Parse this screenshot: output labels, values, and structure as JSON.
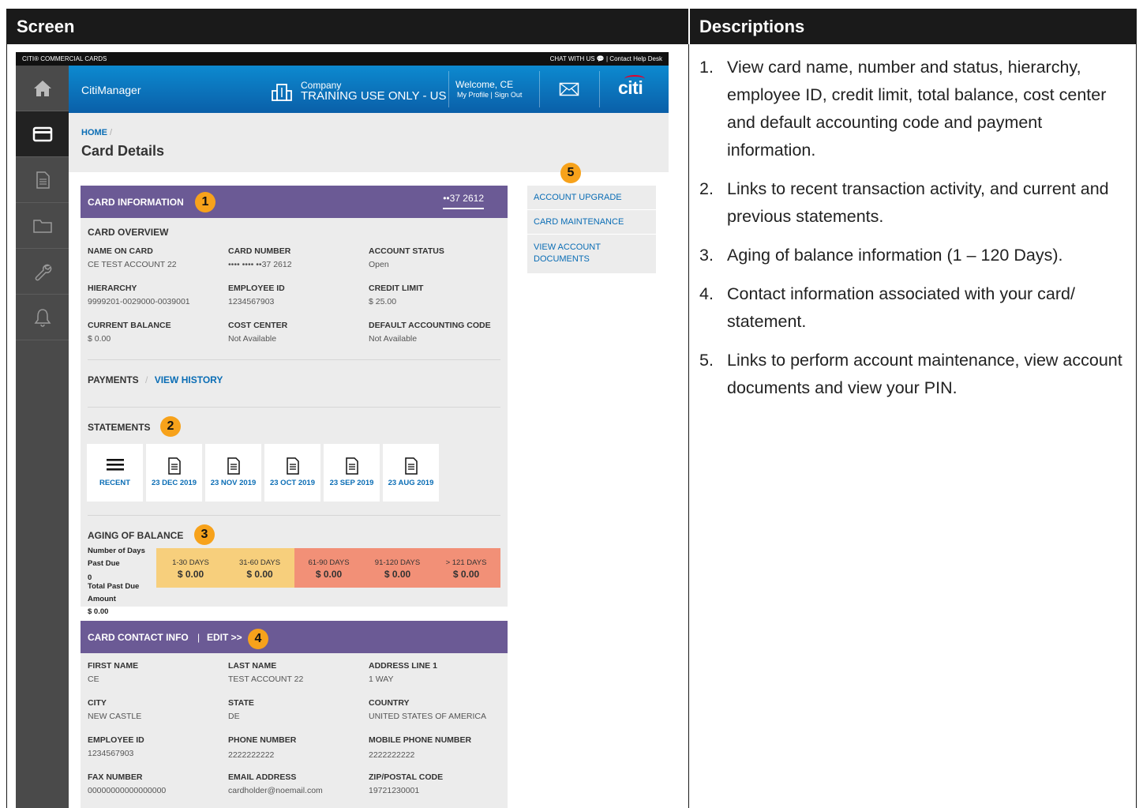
{
  "frame": {
    "screen_heading": "Screen",
    "descriptions_heading": "Descriptions",
    "descriptions": [
      {
        "num": "1.",
        "text": "View card name, number and status, hierarchy, employee ID, credit limit, total balance, cost center and default accounting code and payment information."
      },
      {
        "num": "2.",
        "text": "Links to recent transaction activity, and current and previous statements."
      },
      {
        "num": "3.",
        "text": "Aging of balance information (1 – 120 Days)."
      },
      {
        "num": "4.",
        "text": "Contact information associated with your card/ statement."
      },
      {
        "num": "5.",
        "text": "Links to perform account maintenance, view account documents and view your PIN."
      }
    ]
  },
  "topbar": {
    "brand": "CITI® COMMERCIAL CARDS",
    "right": "CHAT WITH US 💬   |   Contact Help Desk"
  },
  "sidebar": {
    "icons": [
      "home-icon",
      "card-icon",
      "document-icon",
      "folder-icon",
      "wrench-icon",
      "bell-icon"
    ]
  },
  "banner": {
    "app_name": "CitiManager",
    "company_label": "Company",
    "company_name": "TRAINING USE ONLY - US",
    "welcome": "Welcome, CE",
    "my_profile": "My Profile",
    "sign_out": "| Sign Out",
    "logo": "citi",
    "brand_color": "#0a6db5"
  },
  "breadcrumb": {
    "home": "HOME",
    "sep": " /"
  },
  "page_title": "Card Details",
  "card_info": {
    "header": "CARD INFORMATION",
    "badge": "1",
    "card_selector": "••37 2612",
    "overview_title": "CARD OVERVIEW",
    "fields": [
      {
        "label": "NAME ON CARD",
        "value": "CE TEST ACCOUNT 22"
      },
      {
        "label": "CARD NUMBER",
        "value": "•••• •••• ••37 2612"
      },
      {
        "label": "ACCOUNT STATUS",
        "value": "Open"
      },
      {
        "label": "HIERARCHY",
        "value": "9999201-0029000-0039001"
      },
      {
        "label": "EMPLOYEE ID",
        "value": "1234567903"
      },
      {
        "label": "CREDIT LIMIT",
        "value": "$ 25.00"
      },
      {
        "label": "CURRENT BALANCE",
        "value": "$ 0.00"
      },
      {
        "label": "COST CENTER",
        "value": "Not Available"
      },
      {
        "label": "DEFAULT ACCOUNTING CODE",
        "value": "Not Available"
      }
    ],
    "payments": "PAYMENTS",
    "payments_sep": "/",
    "view_history": "VIEW HISTORY",
    "statements_title": "STATEMENTS",
    "statements_badge": "2",
    "statements": [
      "RECENT",
      "23 DEC 2019",
      "23 NOV 2019",
      "23 OCT 2019",
      "23 SEP 2019",
      "23 AUG 2019"
    ],
    "aging_title": "AGING OF BALANCE",
    "aging_badge": "3",
    "aging_left": {
      "days_label": "Number of Days",
      "past_due_label": "Past Due",
      "past_due_value": "0",
      "total_label": "Total Past Due",
      "amount_label": "Amount",
      "amount_value": "$ 0.00"
    },
    "aging_buckets": [
      {
        "label": "1-30 DAYS",
        "value": "$ 0.00"
      },
      {
        "label": "31-60 DAYS",
        "value": "$ 0.00"
      },
      {
        "label": "61-90 DAYS",
        "value": "$ 0.00"
      },
      {
        "label": "91-120 DAYS",
        "value": "$ 0.00"
      },
      {
        "label": "> 121 DAYS",
        "value": "$ 0.00"
      }
    ],
    "aging_colors": {
      "low": "#f7cf7c",
      "high": "#f29077"
    }
  },
  "contact": {
    "header": "CARD CONTACT INFO",
    "sep": "|",
    "edit": "EDIT >>",
    "badge": "4",
    "fields": [
      {
        "label": "FIRST NAME",
        "value": "CE"
      },
      {
        "label": "LAST NAME",
        "value": "TEST ACCOUNT 22"
      },
      {
        "label": "ADDRESS LINE 1",
        "value": "1 WAY"
      },
      {
        "label": "CITY",
        "value": "NEW CASTLE"
      },
      {
        "label": "STATE",
        "value": "DE"
      },
      {
        "label": "COUNTRY",
        "value": "UNITED STATES OF AMERICA"
      },
      {
        "label": "EMPLOYEE ID",
        "value": "1234567903"
      },
      {
        "label": "PHONE NUMBER",
        "value": "2222222222"
      },
      {
        "label": "MOBILE PHONE NUMBER",
        "value": "2222222222"
      },
      {
        "label": "FAX NUMBER",
        "value": "00000000000000000"
      },
      {
        "label": "EMAIL ADDRESS",
        "value": "cardholder@noemail.com"
      },
      {
        "label": "ZIP/POSTAL CODE",
        "value": "19721230001"
      }
    ]
  },
  "right_links": {
    "badge": "5",
    "items": [
      "ACCOUNT UPGRADE",
      "CARD MAINTENANCE",
      "VIEW ACCOUNT DOCUMENTS"
    ]
  }
}
